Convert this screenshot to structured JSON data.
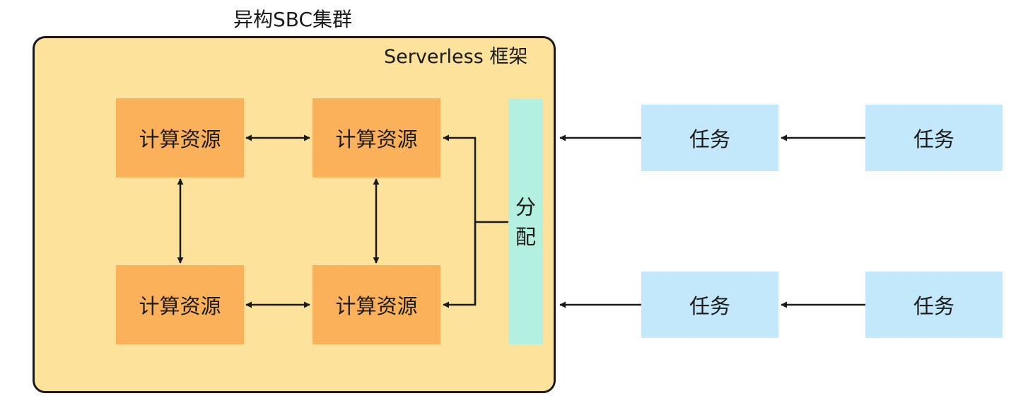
{
  "cluster": {
    "title": "异构SBC集群"
  },
  "framework": {
    "label": "Serverless 框架"
  },
  "resources": [
    {
      "label": "计算资源"
    },
    {
      "label": "计算资源"
    },
    {
      "label": "计算资源"
    },
    {
      "label": "计算资源"
    }
  ],
  "dispatcher": {
    "label": "分配"
  },
  "tasks": [
    {
      "label": "任务"
    },
    {
      "label": "任务"
    },
    {
      "label": "任务"
    },
    {
      "label": "任务"
    }
  ],
  "colors": {
    "framework_fill": "#fde29b",
    "resource_fill": "#fbb159",
    "dispatcher_fill": "#b3f0df",
    "task_fill": "#c3e8fb",
    "line": "#1a1a1a"
  }
}
